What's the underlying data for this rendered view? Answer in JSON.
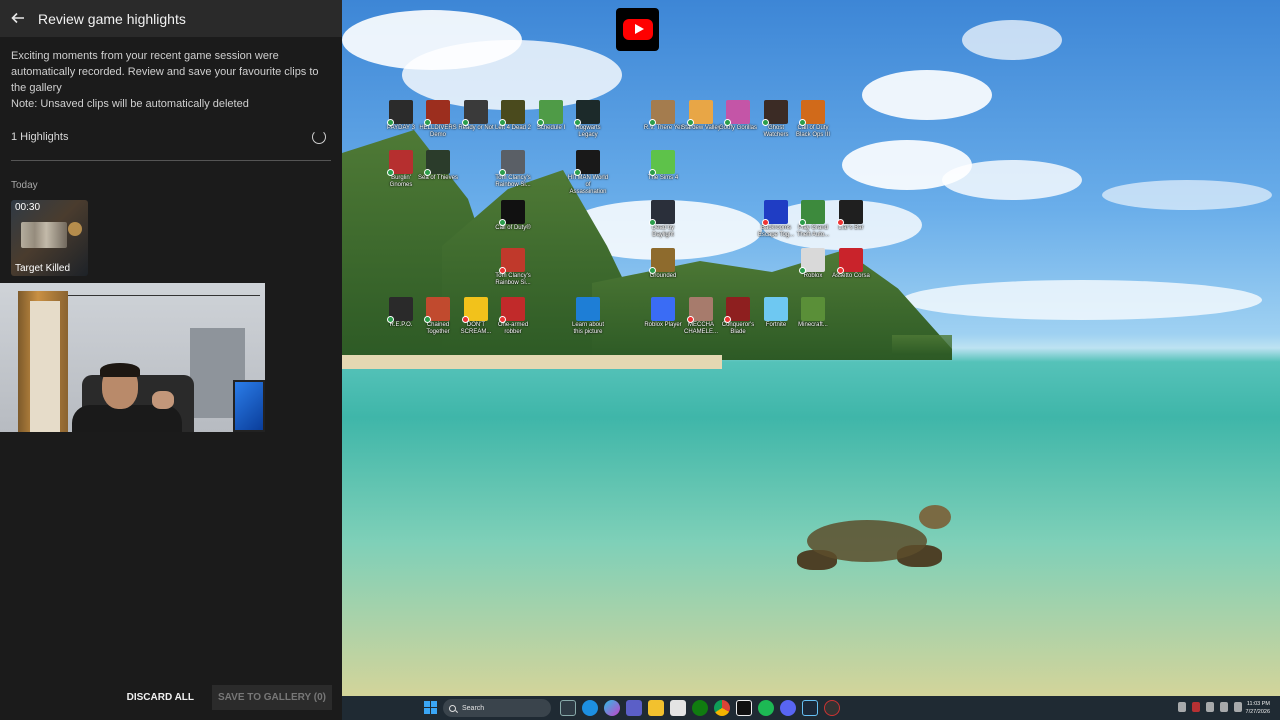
{
  "overlay": {
    "title": "Review game highlights",
    "description_line1": "Exciting moments from your recent game session were automatically recorded. Review and save your favourite clips to the gallery",
    "description_line2": "Note: Unsaved clips will be automatically deleted",
    "highlights_count": "1 Highlights",
    "section_label": "Today",
    "clips": [
      {
        "duration": "00:30",
        "label": "Target Killed"
      }
    ],
    "discard_label": "DISCARD ALL",
    "save_label": "SAVE TO GALLERY (0)"
  },
  "desktop": {
    "icons": [
      {
        "label": "PAYDAY 3",
        "color": "#2b2b2b",
        "badge": "ok"
      },
      {
        "label": "HELLDIVERS Demo",
        "color": "#9c2e1e",
        "badge": "ok"
      },
      {
        "label": "Ready or Not",
        "color": "#3a3a3a",
        "badge": "ok"
      },
      {
        "label": "Left 4 Dead 2",
        "color": "#4a4a1d",
        "badge": "ok"
      },
      {
        "label": "Schedule I",
        "color": "#4f9b47",
        "badge": "ok"
      },
      {
        "label": "Hogwarts Legacy",
        "color": "#1c2a2a",
        "badge": "ok"
      },
      {
        "label": "R.V. There Yet",
        "color": "#a47c4e",
        "badge": "ok"
      },
      {
        "label": "Stardew Valley",
        "color": "#e8a646",
        "badge": "ok"
      },
      {
        "label": "Goofy Gorillas",
        "color": "#c455a7",
        "badge": "ok"
      },
      {
        "label": "Ghost Watchers",
        "color": "#3b2b25",
        "badge": "ok"
      },
      {
        "label": "Call of Duty Black Ops III",
        "color": "#d16a1a",
        "badge": "ok"
      },
      {
        "label": "Burglin' Gnomes",
        "color": "#b62f2f",
        "badge": "ok"
      },
      {
        "label": "Sea of Thieves",
        "color": "#2b3c2b",
        "badge": "ok"
      },
      {
        "label": "Tom Clancy's Rainbow Si...",
        "color": "#5a5f66",
        "badge": "ok"
      },
      {
        "label": "HITMAN World of Assassination",
        "color": "#191919",
        "badge": "ok"
      },
      {
        "label": "The Sims 4",
        "color": "#5ec24a",
        "badge": "ok"
      },
      {
        "label": "Call of Duty®",
        "color": "#111111",
        "badge": "ok"
      },
      {
        "label": "Dead by Daylight",
        "color": "#2a2f3a",
        "badge": "ok"
      },
      {
        "label": "Backrooms Escape Tog...",
        "color": "#1f3dc4",
        "badge": "x"
      },
      {
        "label": "Play Grand Theft Auto...",
        "color": "#3d8a3d",
        "badge": "ok"
      },
      {
        "label": "Liar's Bar",
        "color": "#1f1f1f",
        "badge": "x"
      },
      {
        "label": "Tom Clancy's Rainbow Si...",
        "color": "#c0392b",
        "badge": "x"
      },
      {
        "label": "Grounded",
        "color": "#8e6b2d",
        "badge": "ok"
      },
      {
        "label": "Roblox",
        "color": "#d9d9d9",
        "badge": "ok"
      },
      {
        "label": "Assetto Corsa",
        "color": "#c9232b",
        "badge": "x"
      },
      {
        "label": "R.E.P.O.",
        "color": "#2a2a2a",
        "badge": "ok"
      },
      {
        "label": "Chained Together",
        "color": "#c14a2e",
        "badge": "ok"
      },
      {
        "label": "DON'T SCREAM...",
        "color": "#f2c21b",
        "badge": "x"
      },
      {
        "label": "One-armed robber",
        "color": "#c12a2a",
        "badge": "x"
      },
      {
        "label": "Learn about this picture",
        "color": "#1e7ed6",
        "badge": "none"
      },
      {
        "label": "Roblox Player",
        "color": "#3a6cf5",
        "badge": "none"
      },
      {
        "label": "MECCHA CHAMELE...",
        "color": "#a77b6c",
        "badge": "x"
      },
      {
        "label": "Conqueror's Blade",
        "color": "#8e1f1f",
        "badge": "x"
      },
      {
        "label": "Fortnite",
        "color": "#6ec8f2",
        "badge": "none"
      },
      {
        "label": "Minecraft...",
        "color": "#5a8f38",
        "badge": "none"
      }
    ]
  },
  "taskbar": {
    "search_placeholder": "Search",
    "time": "11:03 PM",
    "date": "7/27/2026"
  }
}
